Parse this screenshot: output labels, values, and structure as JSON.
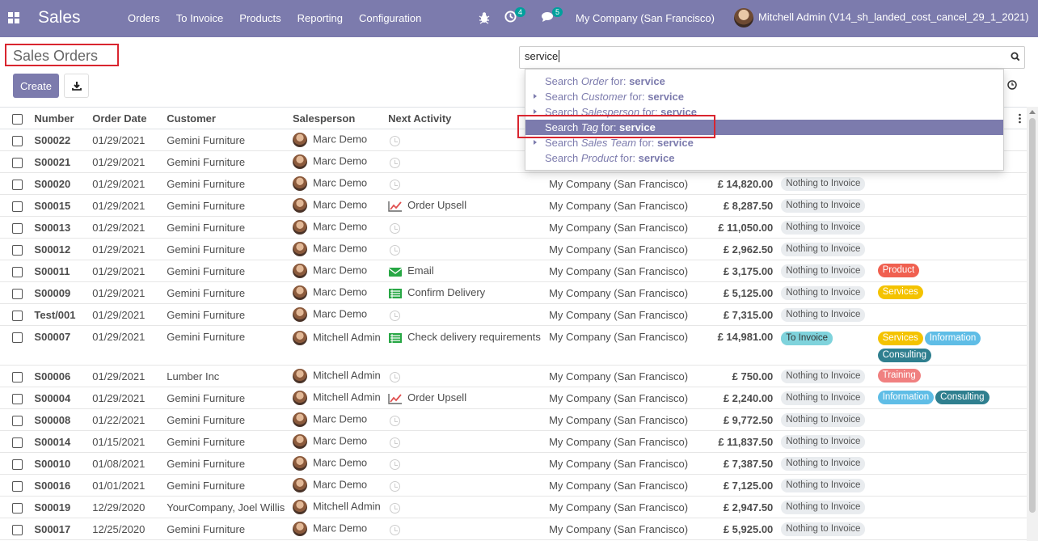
{
  "navbar": {
    "brand": "Sales",
    "menu": [
      "Orders",
      "To Invoice",
      "Products",
      "Reporting",
      "Configuration"
    ],
    "activity_count": "4",
    "message_count": "5",
    "company": "My Company (San Francisco)",
    "user": "Mitchell Admin (V14_sh_landed_cost_cancel_29_1_2021)"
  },
  "control_panel": {
    "breadcrumb": "Sales Orders",
    "create_label": "Create",
    "search_value": "service"
  },
  "dropdown": [
    {
      "prefix": "Search ",
      "field": "Order",
      "mid": " for: ",
      "term": "service",
      "caret": false,
      "active": false
    },
    {
      "prefix": "Search ",
      "field": "Customer",
      "mid": " for: ",
      "term": "service",
      "caret": true,
      "active": false
    },
    {
      "prefix": "Search ",
      "field": "Salesperson",
      "mid": " for: ",
      "term": "service",
      "caret": true,
      "active": false
    },
    {
      "prefix": "Search ",
      "field": "Tag",
      "mid": " for: ",
      "term": "service",
      "caret": false,
      "active": true
    },
    {
      "prefix": "Search ",
      "field": "Sales Team",
      "mid": " for: ",
      "term": "service",
      "caret": true,
      "active": false
    },
    {
      "prefix": "Search ",
      "field": "Product",
      "mid": " for: ",
      "term": "service",
      "caret": false,
      "active": false
    }
  ],
  "table": {
    "headers": {
      "number": "Number",
      "order_date": "Order Date",
      "customer": "Customer",
      "salesperson": "Salesperson",
      "next_activity": "Next Activity"
    },
    "rows": [
      {
        "number": "S00022",
        "date": "01/29/2021",
        "customer": "Gemini Furniture",
        "salesperson": "Marc Demo",
        "activity": "",
        "activity_icon": "",
        "company": "",
        "total": "",
        "invoice": "",
        "tags": []
      },
      {
        "number": "S00021",
        "date": "01/29/2021",
        "customer": "Gemini Furniture",
        "salesperson": "Marc Demo",
        "activity": "",
        "activity_icon": "",
        "company": "",
        "total": "",
        "invoice": "",
        "tags": []
      },
      {
        "number": "S00020",
        "date": "01/29/2021",
        "customer": "Gemini Furniture",
        "salesperson": "Marc Demo",
        "activity": "",
        "activity_icon": "",
        "company": "My Company (San Francisco)",
        "total": "£ 14,820.00",
        "invoice": "Nothing to Invoice",
        "tags": []
      },
      {
        "number": "S00015",
        "date": "01/29/2021",
        "customer": "Gemini Furniture",
        "salesperson": "Marc Demo",
        "activity": "Order Upsell",
        "activity_icon": "upsell",
        "company": "My Company (San Francisco)",
        "total": "£ 8,287.50",
        "invoice": "Nothing to Invoice",
        "tags": []
      },
      {
        "number": "S00013",
        "date": "01/29/2021",
        "customer": "Gemini Furniture",
        "salesperson": "Marc Demo",
        "activity": "",
        "activity_icon": "",
        "company": "My Company (San Francisco)",
        "total": "£ 11,050.00",
        "invoice": "Nothing to Invoice",
        "tags": []
      },
      {
        "number": "S00012",
        "date": "01/29/2021",
        "customer": "Gemini Furniture",
        "salesperson": "Marc Demo",
        "activity": "",
        "activity_icon": "",
        "company": "My Company (San Francisco)",
        "total": "£ 2,962.50",
        "invoice": "Nothing to Invoice",
        "tags": []
      },
      {
        "number": "S00011",
        "date": "01/29/2021",
        "customer": "Gemini Furniture",
        "salesperson": "Marc Demo",
        "activity": "Email",
        "activity_icon": "email",
        "company": "My Company (San Francisco)",
        "total": "£ 3,175.00",
        "invoice": "Nothing to Invoice",
        "tags": [
          {
            "label": "Product",
            "cls": "t-product"
          }
        ]
      },
      {
        "number": "S00009",
        "date": "01/29/2021",
        "customer": "Gemini Furniture",
        "salesperson": "Marc Demo",
        "activity": "Confirm Delivery",
        "activity_icon": "todo",
        "company": "My Company (San Francisco)",
        "total": "£ 5,125.00",
        "invoice": "Nothing to Invoice",
        "tags": [
          {
            "label": "Services",
            "cls": "t-services"
          }
        ]
      },
      {
        "number": "Test/001",
        "date": "01/29/2021",
        "customer": "Gemini Furniture",
        "salesperson": "Marc Demo",
        "activity": "",
        "activity_icon": "",
        "company": "My Company (San Francisco)",
        "total": "£ 7,315.00",
        "invoice": "Nothing to Invoice",
        "tags": []
      },
      {
        "number": "S00007",
        "date": "01/29/2021",
        "customer": "Gemini Furniture",
        "salesperson": "Mitchell Admin",
        "activity": "Check delivery requirements",
        "activity_icon": "todo",
        "company": "My Company (San Francisco)",
        "total": "£ 14,981.00",
        "invoice": "To Invoice",
        "tags": [
          {
            "label": "Services",
            "cls": "t-services"
          },
          {
            "label": "Information",
            "cls": "t-information"
          },
          {
            "label": "Consulting",
            "cls": "t-consulting"
          }
        ],
        "tall": true
      },
      {
        "number": "S00006",
        "date": "01/29/2021",
        "customer": "Lumber Inc",
        "salesperson": "Mitchell Admin",
        "activity": "",
        "activity_icon": "",
        "company": "My Company (San Francisco)",
        "total": "£ 750.00",
        "invoice": "Nothing to Invoice",
        "tags": [
          {
            "label": "Training",
            "cls": "t-training"
          }
        ]
      },
      {
        "number": "S00004",
        "date": "01/29/2021",
        "customer": "Gemini Furniture",
        "salesperson": "Mitchell Admin",
        "activity": "Order Upsell",
        "activity_icon": "upsell",
        "company": "My Company (San Francisco)",
        "total": "£ 2,240.00",
        "invoice": "Nothing to Invoice",
        "tags": [
          {
            "label": "Information",
            "cls": "t-information"
          },
          {
            "label": "Consulting",
            "cls": "t-consulting"
          }
        ]
      },
      {
        "number": "S00008",
        "date": "01/22/2021",
        "customer": "Gemini Furniture",
        "salesperson": "Marc Demo",
        "activity": "",
        "activity_icon": "",
        "company": "My Company (San Francisco)",
        "total": "£ 9,772.50",
        "invoice": "Nothing to Invoice",
        "tags": []
      },
      {
        "number": "S00014",
        "date": "01/15/2021",
        "customer": "Gemini Furniture",
        "salesperson": "Marc Demo",
        "activity": "",
        "activity_icon": "",
        "company": "My Company (San Francisco)",
        "total": "£ 11,837.50",
        "invoice": "Nothing to Invoice",
        "tags": []
      },
      {
        "number": "S00010",
        "date": "01/08/2021",
        "customer": "Gemini Furniture",
        "salesperson": "Marc Demo",
        "activity": "",
        "activity_icon": "",
        "company": "My Company (San Francisco)",
        "total": "£ 7,387.50",
        "invoice": "Nothing to Invoice",
        "tags": []
      },
      {
        "number": "S00016",
        "date": "01/01/2021",
        "customer": "Gemini Furniture",
        "salesperson": "Marc Demo",
        "activity": "",
        "activity_icon": "",
        "company": "My Company (San Francisco)",
        "total": "£ 7,125.00",
        "invoice": "Nothing to Invoice",
        "tags": []
      },
      {
        "number": "S00019",
        "date": "12/29/2020",
        "customer": "YourCompany, Joel Willis",
        "salesperson": "Mitchell Admin",
        "activity": "",
        "activity_icon": "",
        "company": "My Company (San Francisco)",
        "total": "£ 2,947.50",
        "invoice": "Nothing to Invoice",
        "tags": []
      },
      {
        "number": "S00017",
        "date": "12/25/2020",
        "customer": "Gemini Furniture",
        "salesperson": "Marc Demo",
        "activity": "",
        "activity_icon": "",
        "company": "My Company (San Francisco)",
        "total": "£ 5,925.00",
        "invoice": "Nothing to Invoice",
        "tags": []
      }
    ]
  }
}
